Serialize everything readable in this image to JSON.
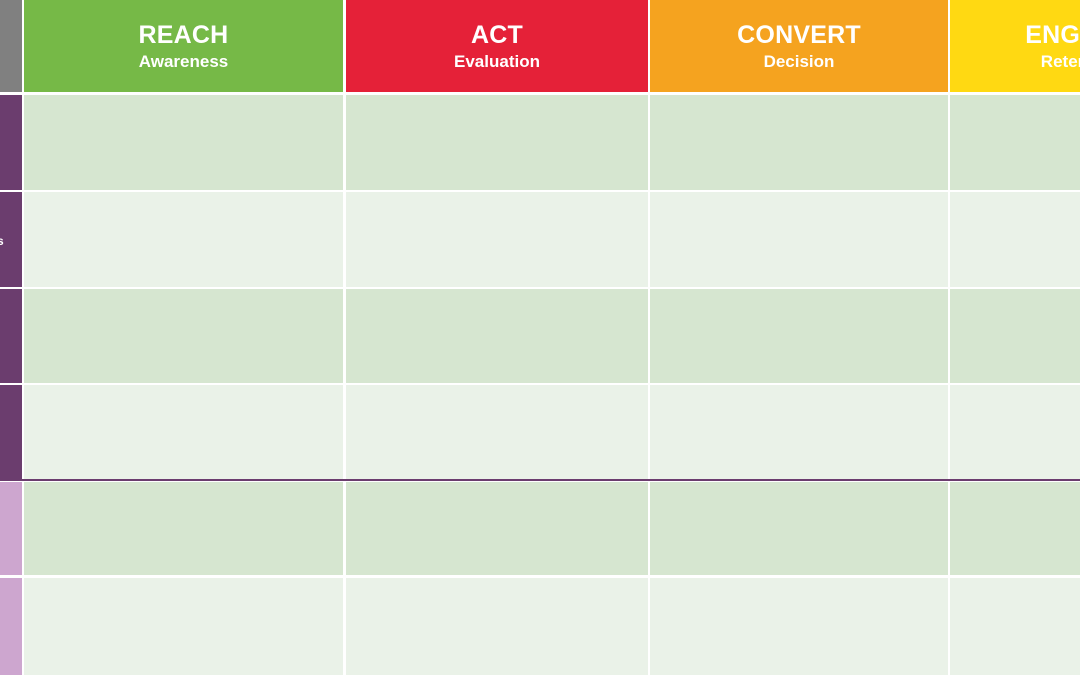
{
  "corner": {
    "color": "#808080"
  },
  "stages": [
    {
      "title": "REACH",
      "subtitle": "Awareness",
      "color": "#76b947"
    },
    {
      "title": "ACT",
      "subtitle": "Evaluation",
      "color": "#e52138"
    },
    {
      "title": "CONVERT",
      "subtitle": "Decision",
      "color": "#f5a31f"
    },
    {
      "title": "ENGAGE",
      "subtitle": "Retention",
      "color": "#ffd912"
    }
  ],
  "row_groups": [
    {
      "color": "#6b3d6e",
      "rows": 4,
      "partial_label": "s"
    },
    {
      "color": "#cda6cf",
      "rows": 2
    }
  ],
  "cell_colors": {
    "dark": "#d6e6d0",
    "light": "#eaf2e8"
  },
  "cells": [
    [
      "",
      "",
      "",
      ""
    ],
    [
      "",
      "",
      "",
      ""
    ],
    [
      "",
      "",
      "",
      ""
    ],
    [
      "",
      "",
      "",
      ""
    ],
    [
      "",
      "",
      "",
      ""
    ],
    [
      "",
      "",
      "",
      ""
    ]
  ]
}
